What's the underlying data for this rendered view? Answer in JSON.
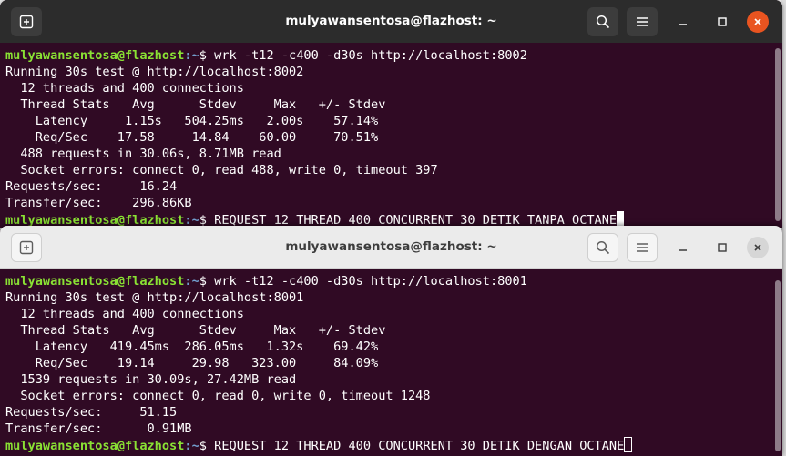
{
  "colors": {
    "terminal_bg": "#300a24",
    "prompt_user": "#8ae234",
    "prompt_path": "#729fcf",
    "text": "#ffffff",
    "close_active": "#e95420"
  },
  "icons": {
    "new_tab": "new-tab-icon",
    "search": "search-icon",
    "menu": "hamburger-menu-icon",
    "minimize": "minimize-icon",
    "maximize": "maximize-icon",
    "close": "close-icon"
  },
  "window_top": {
    "title": "mulyawansentosa@flazhost: ~",
    "prompt_user": "mulyawansentosa@flazhost",
    "prompt_path": ":~",
    "prompt_symbol": "$ ",
    "command": "wrk -t12 -c400 -d30s http://localhost:8002",
    "output": [
      "Running 30s test @ http://localhost:8002",
      "  12 threads and 400 connections",
      "  Thread Stats   Avg      Stdev     Max   +/- Stdev",
      "    Latency     1.15s   504.25ms   2.00s    57.14%",
      "    Req/Sec    17.58     14.84    60.00     70.51%",
      "  488 requests in 30.06s, 8.71MB read",
      "  Socket errors: connect 0, read 488, write 0, timeout 397",
      "Requests/sec:     16.24",
      "Transfer/sec:    296.86KB"
    ],
    "current_input": "REQUEST 12 THREAD 400 CONCURRENT 30 DETIK TANPA OCTANE"
  },
  "window_bottom": {
    "title": "mulyawansentosa@flazhost: ~",
    "prompt_user": "mulyawansentosa@flazhost",
    "prompt_path": ":~",
    "prompt_symbol": "$ ",
    "command": "wrk -t12 -c400 -d30s http://localhost:8001",
    "output": [
      "Running 30s test @ http://localhost:8001",
      "  12 threads and 400 connections",
      "  Thread Stats   Avg      Stdev     Max   +/- Stdev",
      "    Latency   419.45ms  286.05ms   1.32s    69.42%",
      "    Req/Sec    19.14     29.98   323.00     84.09%",
      "  1539 requests in 30.09s, 27.42MB read",
      "  Socket errors: connect 0, read 0, write 0, timeout 1248",
      "Requests/sec:     51.15",
      "Transfer/sec:      0.91MB"
    ],
    "current_input": "REQUEST 12 THREAD 400 CONCURRENT 30 DETIK DENGAN OCTANE"
  }
}
